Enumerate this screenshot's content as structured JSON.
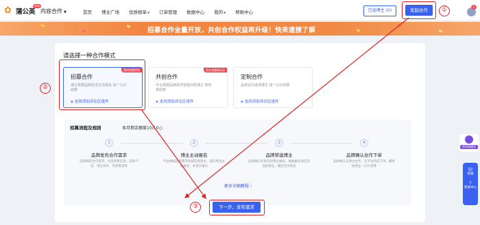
{
  "nav": {
    "brand": "蒲公英",
    "brand_badge": "new",
    "business": "内容合作",
    "menu": [
      {
        "label": "首页",
        "dropdown": false
      },
      {
        "label": "博主广场",
        "dropdown": false
      },
      {
        "label": "优质榜单",
        "dropdown": true
      },
      {
        "label": "订单管理",
        "dropdown": false
      },
      {
        "label": "数据中心",
        "dropdown": false
      },
      {
        "label": "我的",
        "dropdown": true
      },
      {
        "label": "帮助中心",
        "dropdown": false
      }
    ],
    "selected_creators": "已选博主 (0)",
    "launch_cooperation": "发起合作",
    "notification_count": "2"
  },
  "banner": {
    "text": "招募合作全量开放，共创合作权益再升级！快来速撩了解"
  },
  "panel": {
    "title": "请选择一种合作模式",
    "cards": [
      {
        "title": "招募合作",
        "ribbon": "限时免费特权",
        "desc": "博主根据品牌需求主动报名 按一口价结算",
        "tag": "支持添加评论区组件",
        "selected": true
      },
      {
        "title": "共创合作",
        "ribbon": "任务流量新玩法",
        "desc": "平台根据品牌需求智能匹配博主 按效果结算",
        "tag": "支持添加评论区组件",
        "selected": false
      },
      {
        "title": "定制合作",
        "ribbon": "",
        "desc": "品牌定向选择博主 按一口价结算",
        "tag": "支持添加评论区组件",
        "selected": false
      }
    ],
    "process": {
      "heading": "招募流程及规则",
      "quota": "本月剩余额度10/10",
      "steps": [
        {
          "num": "1",
          "title": "品牌发布合作需求",
          "desc": "品牌确定合作需求，包括项目信息、品牌介绍、博主条件、内容需求等"
        },
        {
          "num": "2",
          "title": "博主主动报名",
          "desc": "平台根据品牌需求智能匹配博主，意向博主主动报名，并提交报价"
        },
        {
          "num": "3",
          "title": "品牌筛选博主",
          "desc": "品牌确认有意向的博主报名，根据报名表信息选择博主，确定合作博主"
        },
        {
          "num": "4",
          "title": "品牌确认合作下单",
          "desc": "品牌确认与博主合作，在平台完成下单，最终按博主一口价结算"
        }
      ],
      "more_link": "更多详细教程"
    },
    "next_button": "下一步，发布需求"
  },
  "annotations": {
    "marker_1": "①",
    "marker_2": "②",
    "marker_3": "③",
    "color": "#e02020"
  },
  "side": {
    "mode_label": "合作新模式",
    "items": [
      {
        "icon": "headset-icon",
        "label": "客服"
      },
      {
        "icon": "help-icon",
        "label": "帮助中心"
      }
    ]
  },
  "colors": {
    "primary": "#3a62f0",
    "banner": "#f3843f",
    "ribbon": "#f0494e"
  }
}
